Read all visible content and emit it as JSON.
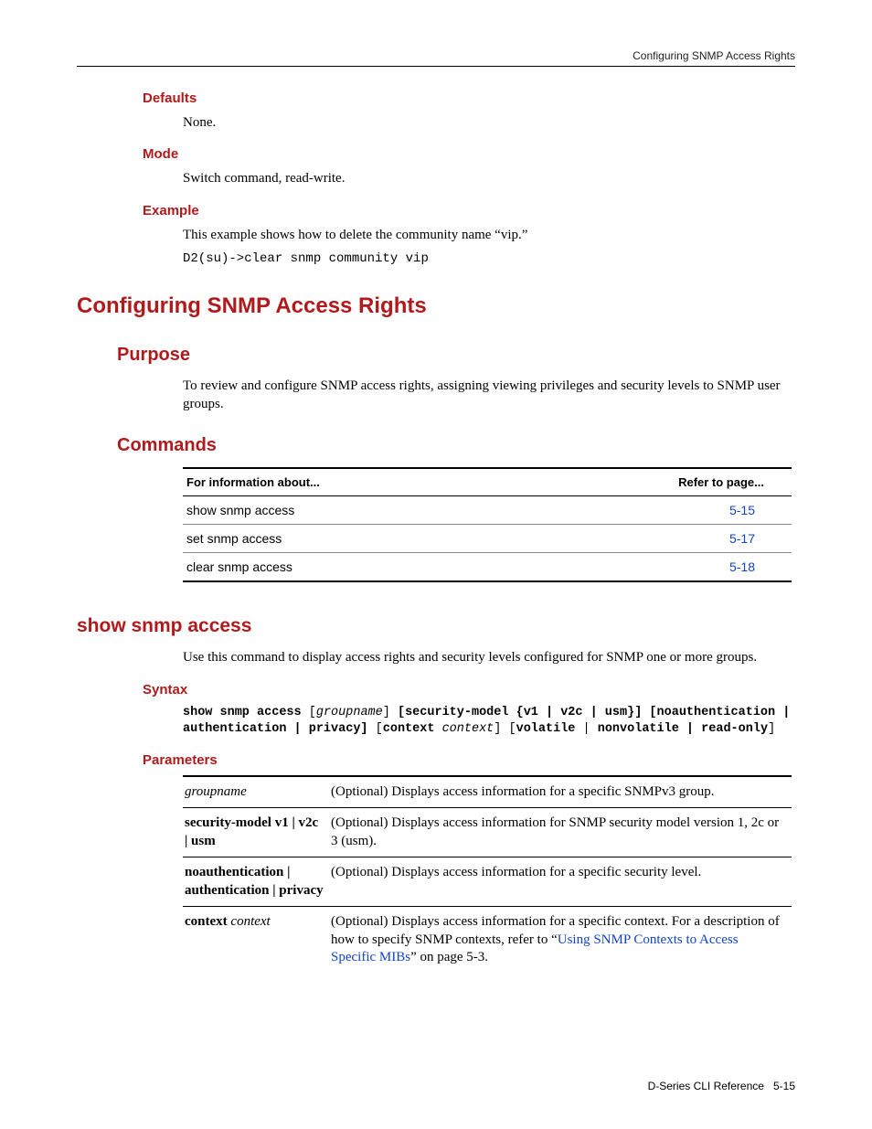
{
  "header": {
    "section": "Configuring SNMP Access Rights"
  },
  "defaults": {
    "heading": "Defaults",
    "body": "None."
  },
  "mode": {
    "heading": "Mode",
    "body": "Switch command, read-write."
  },
  "example": {
    "heading": "Example",
    "intro": "This example shows how to delete the community name “vip.”",
    "code": "D2(su)->clear snmp community vip"
  },
  "mainHeading": "Configuring SNMP Access Rights",
  "purpose": {
    "heading": "Purpose",
    "body": "To review and configure SNMP access rights, assigning viewing privileges and security levels to SNMP user groups."
  },
  "commands": {
    "heading": "Commands",
    "col1": "For information about...",
    "col2": "Refer to page...",
    "rows": [
      {
        "name": "show snmp access",
        "page": "5-15"
      },
      {
        "name": "set snmp access",
        "page": "5-17"
      },
      {
        "name": "clear snmp access",
        "page": "5-18"
      }
    ]
  },
  "showCmd": {
    "heading": "show snmp access",
    "intro": "Use this command to display access rights and security levels configured for SNMP one or more groups.",
    "syntaxHeading": "Syntax",
    "syntax": {
      "p1": "show snmp access ",
      "p2": "[",
      "p3": "groupname",
      "p4": "] ",
      "p5": "[security-model {v1 | v2c | usm}] [noauthentication | authentication | privacy] ",
      "p6": "[",
      "p7": "context ",
      "p8": "context",
      "p9": "] [",
      "p10": "volatile ",
      "p11": "| ",
      "p12": "nonvolatile | read-only",
      "p13": "]"
    },
    "paramsHeading": "Parameters",
    "params": {
      "r1n": "groupname",
      "r1d": "(Optional) Displays access information for a specific SNMPv3 group.",
      "r2n": "security-model v1 | v2c | usm",
      "r2d": "(Optional) Displays access information for SNMP security model version 1, 2c or 3 (usm).",
      "r3n": "noauthentication | authentication | privacy",
      "r3d": "(Optional) Displays access information for a specific security level.",
      "r4n1": "context ",
      "r4n2": "context",
      "r4d1": "(Optional) Displays access information for a specific context. For a description of how to specify SNMP contexts, refer to “",
      "r4d2": "Using SNMP Contexts to Access Specific MIBs",
      "r4d3": "” on page 5-3."
    }
  },
  "footer": {
    "book": "D-Series CLI Reference",
    "page": "5-15"
  }
}
